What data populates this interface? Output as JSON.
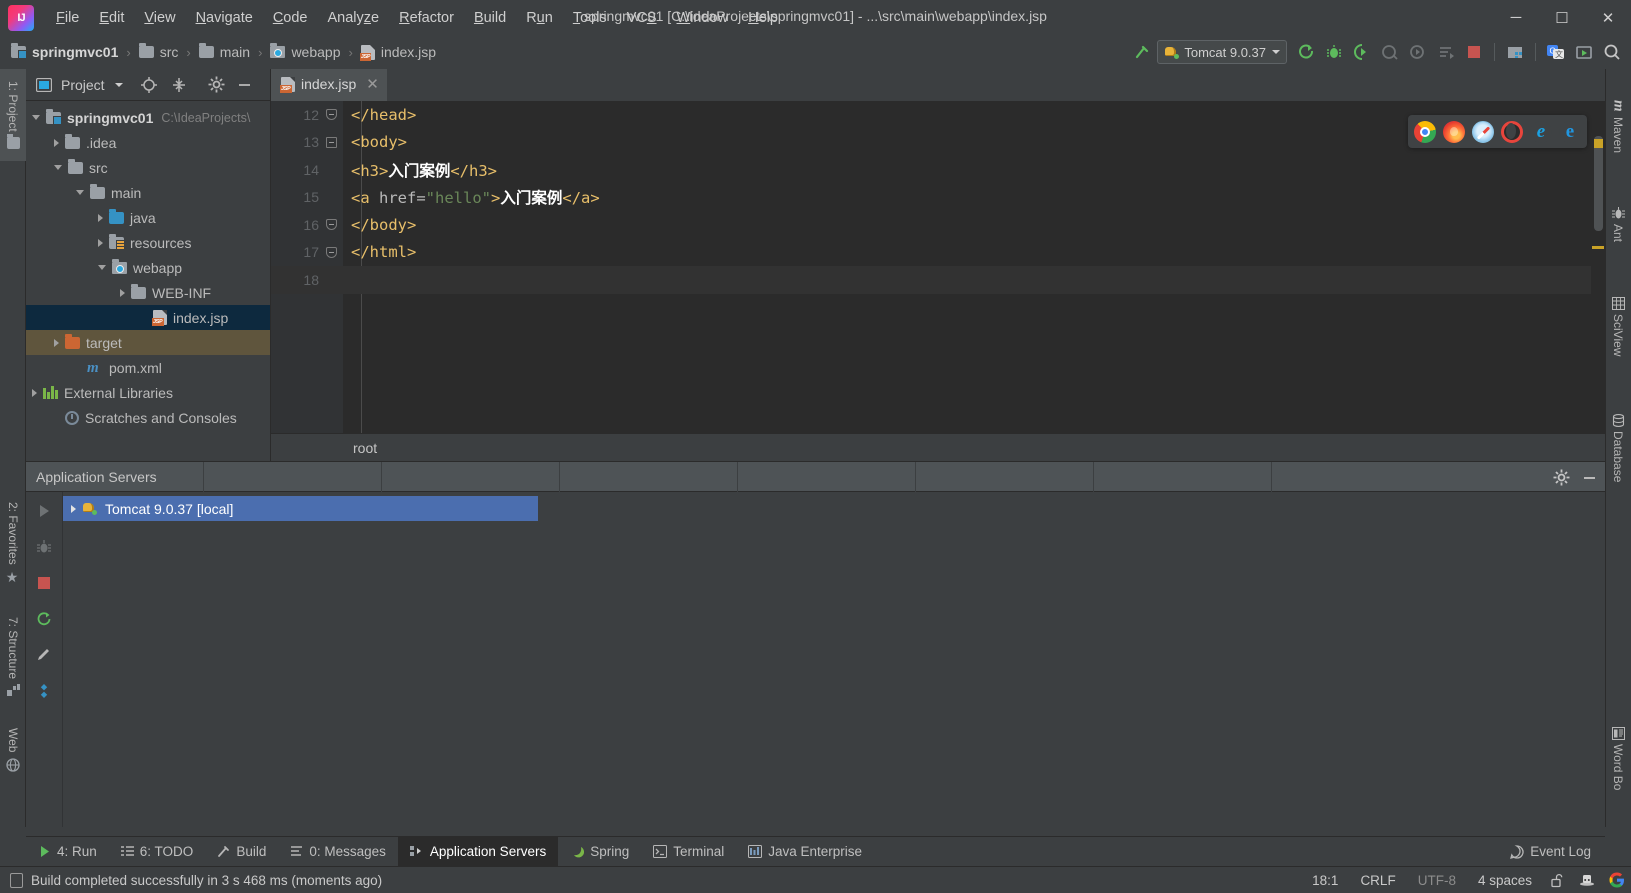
{
  "window": {
    "title": "springmvc01 [C:\\IdeaProjects\\springmvc01] - ...\\src\\main\\webapp\\index.jsp",
    "minimize": "─",
    "maximize": "☐",
    "close": "✕"
  },
  "menubar": {
    "logo": "intellij-idea-logo",
    "items": [
      {
        "label": "File",
        "mnemonic": "F"
      },
      {
        "label": "Edit",
        "mnemonic": "E"
      },
      {
        "label": "View",
        "mnemonic": "V"
      },
      {
        "label": "Navigate",
        "mnemonic": "N"
      },
      {
        "label": "Code",
        "mnemonic": "C"
      },
      {
        "label": "Analyze",
        "mnemonic": "z"
      },
      {
        "label": "Refactor",
        "mnemonic": "R"
      },
      {
        "label": "Build",
        "mnemonic": "B"
      },
      {
        "label": "Run",
        "mnemonic": "u"
      },
      {
        "label": "Tools",
        "mnemonic": "T"
      },
      {
        "label": "VCS",
        "mnemonic": "S"
      },
      {
        "label": "Window",
        "mnemonic": "W"
      },
      {
        "label": "Help",
        "mnemonic": "H"
      }
    ]
  },
  "navbar": {
    "breadcrumbs": [
      {
        "label": "springmvc01",
        "icon": "module-folder-icon",
        "bold": true
      },
      {
        "label": "src",
        "icon": "folder-icon",
        "bold": false
      },
      {
        "label": "main",
        "icon": "folder-icon",
        "bold": false
      },
      {
        "label": "webapp",
        "icon": "web-folder-icon",
        "bold": false
      },
      {
        "label": "index.jsp",
        "icon": "jsp-file-icon",
        "bold": false
      }
    ],
    "separator": "›",
    "run_config": {
      "label": "Tomcat 9.0.37",
      "icon": "tomcat-icon"
    },
    "buttons": [
      {
        "name": "build-hammer-icon",
        "title": "Build"
      },
      {
        "name": "run-icon",
        "title": "Run"
      },
      {
        "name": "debug-icon",
        "title": "Debug"
      },
      {
        "name": "run-with-coverage-icon",
        "title": "Run with Coverage"
      },
      {
        "name": "attach-profiler-icon",
        "title": "Profiler"
      },
      {
        "name": "profile-icon",
        "title": "Profile"
      },
      {
        "name": "run-dashboard-icon",
        "title": "Services"
      },
      {
        "name": "stop-icon",
        "title": "Stop"
      },
      {
        "name": "project-structure-icon",
        "title": "Project Structure"
      },
      {
        "name": "translate-icon",
        "title": "Translate"
      },
      {
        "name": "update-project-icon",
        "title": "Update"
      },
      {
        "name": "search-everywhere-icon",
        "title": "Search Everywhere"
      }
    ]
  },
  "left_stripe": {
    "top": [
      {
        "label": "1: Project",
        "icon": "project-folder-icon",
        "active": true
      }
    ],
    "bottom": [
      {
        "label": "2: Favorites",
        "icon": "star-icon",
        "active": false
      },
      {
        "label": "7: Structure",
        "icon": "structure-icon",
        "active": false
      },
      {
        "label": "Web",
        "icon": "web-icon",
        "active": false
      }
    ]
  },
  "right_stripe": {
    "items": [
      {
        "label": "Maven",
        "icon": "maven-icon"
      },
      {
        "label": "Ant",
        "icon": "ant-icon"
      },
      {
        "label": "SciView",
        "icon": "sciview-icon"
      },
      {
        "label": "Database",
        "icon": "database-icon"
      },
      {
        "label": "Word Bo",
        "icon": "word-book-icon"
      }
    ]
  },
  "project_panel": {
    "title": "Project",
    "header_icons": [
      {
        "name": "project-view-icon"
      },
      {
        "name": "chevron-down-icon"
      },
      {
        "name": "locate-target-icon"
      },
      {
        "name": "collapse-all-icon"
      },
      {
        "name": "gear-icon"
      },
      {
        "name": "hide-icon"
      }
    ],
    "tree": [
      {
        "label": "springmvc01",
        "path": "C:\\IdeaProjects\\",
        "indent": 0,
        "twisty": "open",
        "icon": "module-folder-icon",
        "bold": true,
        "state": "normal"
      },
      {
        "label": ".idea",
        "path": "",
        "indent": 1,
        "twisty": "closed",
        "icon": "folder-icon",
        "bold": false,
        "state": "normal"
      },
      {
        "label": "src",
        "path": "",
        "indent": 1,
        "twisty": "open",
        "icon": "folder-icon",
        "bold": false,
        "state": "normal"
      },
      {
        "label": "main",
        "path": "",
        "indent": 2,
        "twisty": "open",
        "icon": "folder-icon",
        "bold": false,
        "state": "normal"
      },
      {
        "label": "java",
        "path": "",
        "indent": 3,
        "twisty": "closed",
        "icon": "source-folder-icon",
        "bold": false,
        "state": "normal"
      },
      {
        "label": "resources",
        "path": "",
        "indent": 3,
        "twisty": "closed",
        "icon": "resource-folder-icon",
        "bold": false,
        "state": "normal"
      },
      {
        "label": "webapp",
        "path": "",
        "indent": 3,
        "twisty": "open",
        "icon": "web-folder-icon",
        "bold": false,
        "state": "normal"
      },
      {
        "label": "WEB-INF",
        "path": "",
        "indent": 4,
        "twisty": "closed",
        "icon": "folder-icon",
        "bold": false,
        "state": "normal"
      },
      {
        "label": "index.jsp",
        "path": "",
        "indent": 5,
        "twisty": "none",
        "icon": "jsp-file-icon",
        "bold": false,
        "state": "selected"
      },
      {
        "label": "target",
        "path": "",
        "indent": 1,
        "twisty": "closed",
        "icon": "excluded-folder-icon",
        "bold": false,
        "state": "highlighted"
      },
      {
        "label": "pom.xml",
        "path": "",
        "indent": 2,
        "twisty": "none",
        "icon": "maven-file-icon",
        "bold": false,
        "state": "normal"
      },
      {
        "label": "External Libraries",
        "path": "",
        "indent": 0,
        "twisty": "closed",
        "icon": "libraries-icon",
        "bold": false,
        "state": "normal"
      },
      {
        "label": "Scratches and Consoles",
        "path": "",
        "indent": 0,
        "twisty": "none",
        "icon": "scratches-icon",
        "bold": false,
        "state": "normal"
      }
    ]
  },
  "editor": {
    "tab": {
      "label": "index.jsp",
      "icon": "jsp-file-icon",
      "close": "✕"
    },
    "breadcrumb": "root",
    "first_line": 12,
    "lines": [
      {
        "num": 12,
        "fold": "end",
        "tokens": [
          {
            "t": "tag",
            "v": "</head>"
          }
        ]
      },
      {
        "num": 13,
        "fold": "start",
        "tokens": [
          {
            "t": "tag",
            "v": "<body>"
          }
        ]
      },
      {
        "num": 14,
        "fold": "none",
        "tokens": [
          {
            "t": "tag",
            "v": "<h3>"
          },
          {
            "t": "txt",
            "v": "入门案例"
          },
          {
            "t": "tag",
            "v": "</h3>"
          }
        ]
      },
      {
        "num": 15,
        "fold": "none",
        "tokens": [
          {
            "t": "tag",
            "v": "<a "
          },
          {
            "t": "attr",
            "v": "href="
          },
          {
            "t": "str",
            "v": "\"hello\""
          },
          {
            "t": "tag",
            "v": ">"
          },
          {
            "t": "txt",
            "v": "入门案例"
          },
          {
            "t": "tag",
            "v": "</a>"
          }
        ]
      },
      {
        "num": 16,
        "fold": "end",
        "tokens": [
          {
            "t": "tag",
            "v": "</body>"
          }
        ]
      },
      {
        "num": 17,
        "fold": "end",
        "tokens": [
          {
            "t": "tag",
            "v": "</html>"
          }
        ]
      },
      {
        "num": 18,
        "fold": "none",
        "tokens": []
      }
    ],
    "browsers": [
      {
        "name": "chrome-icon",
        "label": "Chrome"
      },
      {
        "name": "firefox-icon",
        "label": "Firefox"
      },
      {
        "name": "safari-icon",
        "label": "Safari"
      },
      {
        "name": "opera-icon",
        "label": "Opera"
      },
      {
        "name": "internet-explorer-icon",
        "label": "Internet Explorer",
        "glyph": "e"
      },
      {
        "name": "edge-icon",
        "label": "Edge",
        "glyph": "e"
      }
    ]
  },
  "app_servers": {
    "tab_label": "Application Servers",
    "header_icons": [
      {
        "name": "gear-icon"
      },
      {
        "name": "hide-icon"
      }
    ],
    "left_tools": [
      {
        "name": "run-icon"
      },
      {
        "name": "debug-icon"
      },
      {
        "name": "stop-icon"
      },
      {
        "name": "restart-icon"
      },
      {
        "name": "edit-icon"
      },
      {
        "name": "settings-diamond-icon"
      }
    ],
    "rows": [
      {
        "label": "Tomcat 9.0.37 [local]",
        "icon": "tomcat-icon",
        "twisty": "closed",
        "selected": true
      }
    ]
  },
  "bottom_tabs": [
    {
      "label": "4: Run",
      "mnemonic": "4",
      "icon": "run-icon",
      "active": false
    },
    {
      "label": "6: TODO",
      "mnemonic": "6",
      "icon": "todo-icon",
      "active": false
    },
    {
      "label": "Build",
      "mnemonic": "",
      "icon": "build-icon",
      "active": false
    },
    {
      "label": "0: Messages",
      "mnemonic": "0",
      "icon": "messages-icon",
      "active": false
    },
    {
      "label": "Application Servers",
      "mnemonic": "",
      "icon": "app-servers-icon",
      "active": true
    },
    {
      "label": "Spring",
      "mnemonic": "",
      "icon": "spring-icon",
      "active": false
    },
    {
      "label": "Terminal",
      "mnemonic": "",
      "icon": "terminal-icon",
      "active": false
    },
    {
      "label": "Java Enterprise",
      "mnemonic": "",
      "icon": "java-ee-icon",
      "active": false
    }
  ],
  "event_log": {
    "label": "Event Log",
    "icon": "event-log-icon"
  },
  "statusbar": {
    "message": "Build completed successfully in 3 s 468 ms (moments ago)",
    "message_icon": "build-status-icon",
    "position": "18:1",
    "line_separator": "CRLF",
    "encoding": "UTF-8",
    "indent": "4 spaces",
    "icons": [
      {
        "name": "lock-open-icon"
      },
      {
        "name": "inspector-hat-icon"
      },
      {
        "name": "google-icon"
      }
    ]
  },
  "colors": {
    "bg": "#3c3f41",
    "editor_bg": "#2b2b2b",
    "selection": "#4b6eaf",
    "tree_selection": "#0d293e",
    "target_highlight": "#5f553d",
    "tag": "#e8bf6a",
    "string": "#6a8759",
    "text": "#ffffff"
  }
}
